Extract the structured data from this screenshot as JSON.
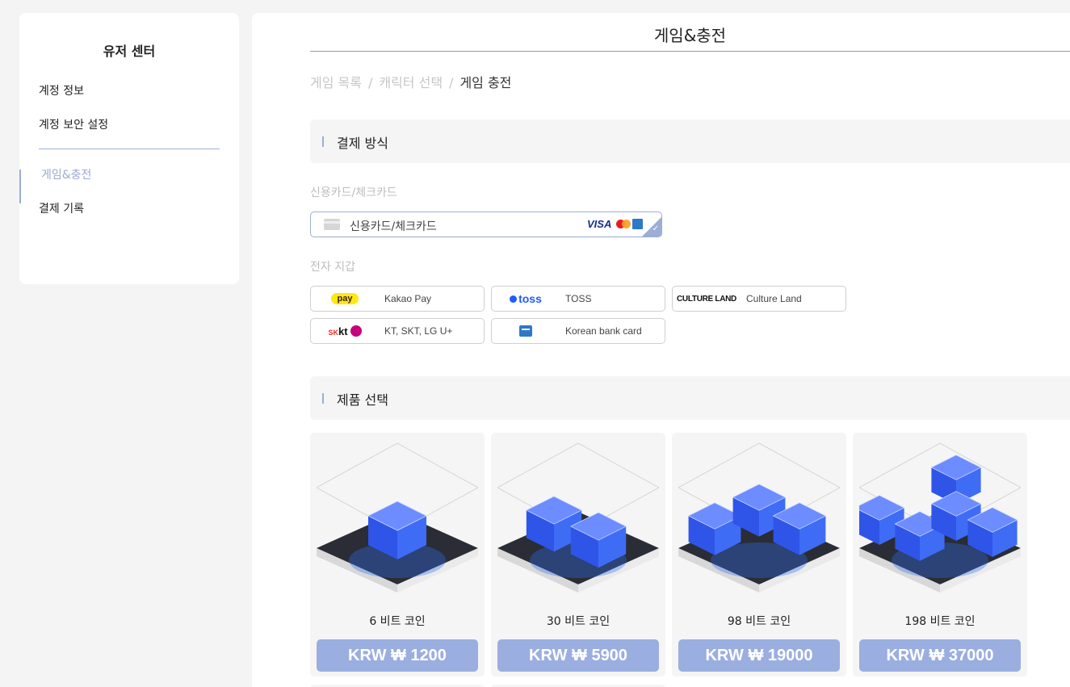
{
  "sidebar": {
    "title": "유저 센터",
    "items": [
      {
        "label": "계정 정보"
      },
      {
        "label": "계정 보안 설정"
      },
      {
        "label": "게임&충전"
      },
      {
        "label": "결제 기록"
      }
    ]
  },
  "main": {
    "title": "게임&충전",
    "breadcrumb": [
      "게임 목록",
      "캐릭터 선택",
      "게임 충전"
    ],
    "breadcrumb_sep": "/",
    "payment_section": "결제 방식",
    "card_group_label": "신용카드/체크카드",
    "card_option": {
      "label": "신용카드/체크카드",
      "brand_visa": "VISA",
      "selected": true
    },
    "wallet_group_label": "전자 지갑",
    "wallets": [
      {
        "logo_text": "pay",
        "label": "Kakao Pay",
        "icon": "kakaopay-logo"
      },
      {
        "logo_text": "toss",
        "label": "TOSS",
        "icon": "toss-logo"
      },
      {
        "logo_text": "CULTURE LAND",
        "label": "Culture Land",
        "icon": "cultureland-logo"
      },
      {
        "logo_text": "kt",
        "label": "KT, SKT, LG U+",
        "icon": "telco-logo"
      },
      {
        "logo_text": "",
        "label": "Korean bank card",
        "icon": "bank-card-logo"
      }
    ],
    "product_section": "제품 선택",
    "products": [
      {
        "name": "6 비트 코인",
        "price": "KRW ₩ 1200",
        "cubes": 1
      },
      {
        "name": "30 비트 코인",
        "price": "KRW ₩ 5900",
        "cubes": 2
      },
      {
        "name": "98 비트 코인",
        "price": "KRW ₩ 19000",
        "cubes": 3
      },
      {
        "name": "198 비트 코인",
        "price": "KRW ₩ 37000",
        "cubes": 5
      }
    ]
  },
  "colors": {
    "accent": "#9aaed6",
    "price_button": "#9aaee0",
    "panel_bg": "#f5f5f5"
  }
}
